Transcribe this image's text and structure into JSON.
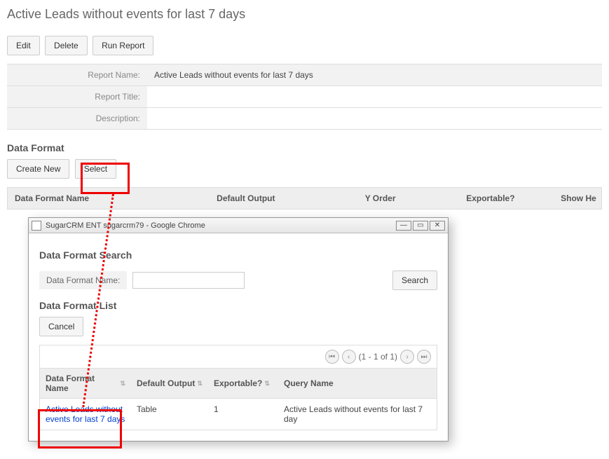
{
  "page": {
    "title": "Active Leads without events for last 7 days"
  },
  "toolbar": {
    "edit": "Edit",
    "delete": "Delete",
    "run": "Run Report"
  },
  "details": {
    "report_name_label": "Report Name:",
    "report_name_value": "Active Leads without events for last 7 days",
    "report_title_label": "Report Title:",
    "report_title_value": "",
    "description_label": "Description:",
    "description_value": ""
  },
  "data_format": {
    "section_title": "Data Format",
    "create_new": "Create New",
    "select": "Select",
    "columns": {
      "name": "Data Format Name",
      "default_output": "Default Output",
      "y_order": "Y Order",
      "exportable": "Exportable?",
      "show_header": "Show He"
    }
  },
  "popup": {
    "chrome_title": "SugarCRM ENT sugarcrm79 - Google Chrome",
    "search_section": "Data Format Search",
    "search_field_label": "Data Format Name:",
    "search_button": "Search",
    "list_section": "Data Format List",
    "cancel": "Cancel",
    "pager_text": "(1 - 1 of 1)",
    "columns": {
      "name": "Data Format Name",
      "default_output": "Default Output",
      "exportable": "Exportable?",
      "query_name": "Query Name"
    },
    "row": {
      "name": "Active Leads without events for last 7 days",
      "default_output": "Table",
      "exportable": "1",
      "query_name": "Active Leads without events for last 7 day"
    }
  }
}
